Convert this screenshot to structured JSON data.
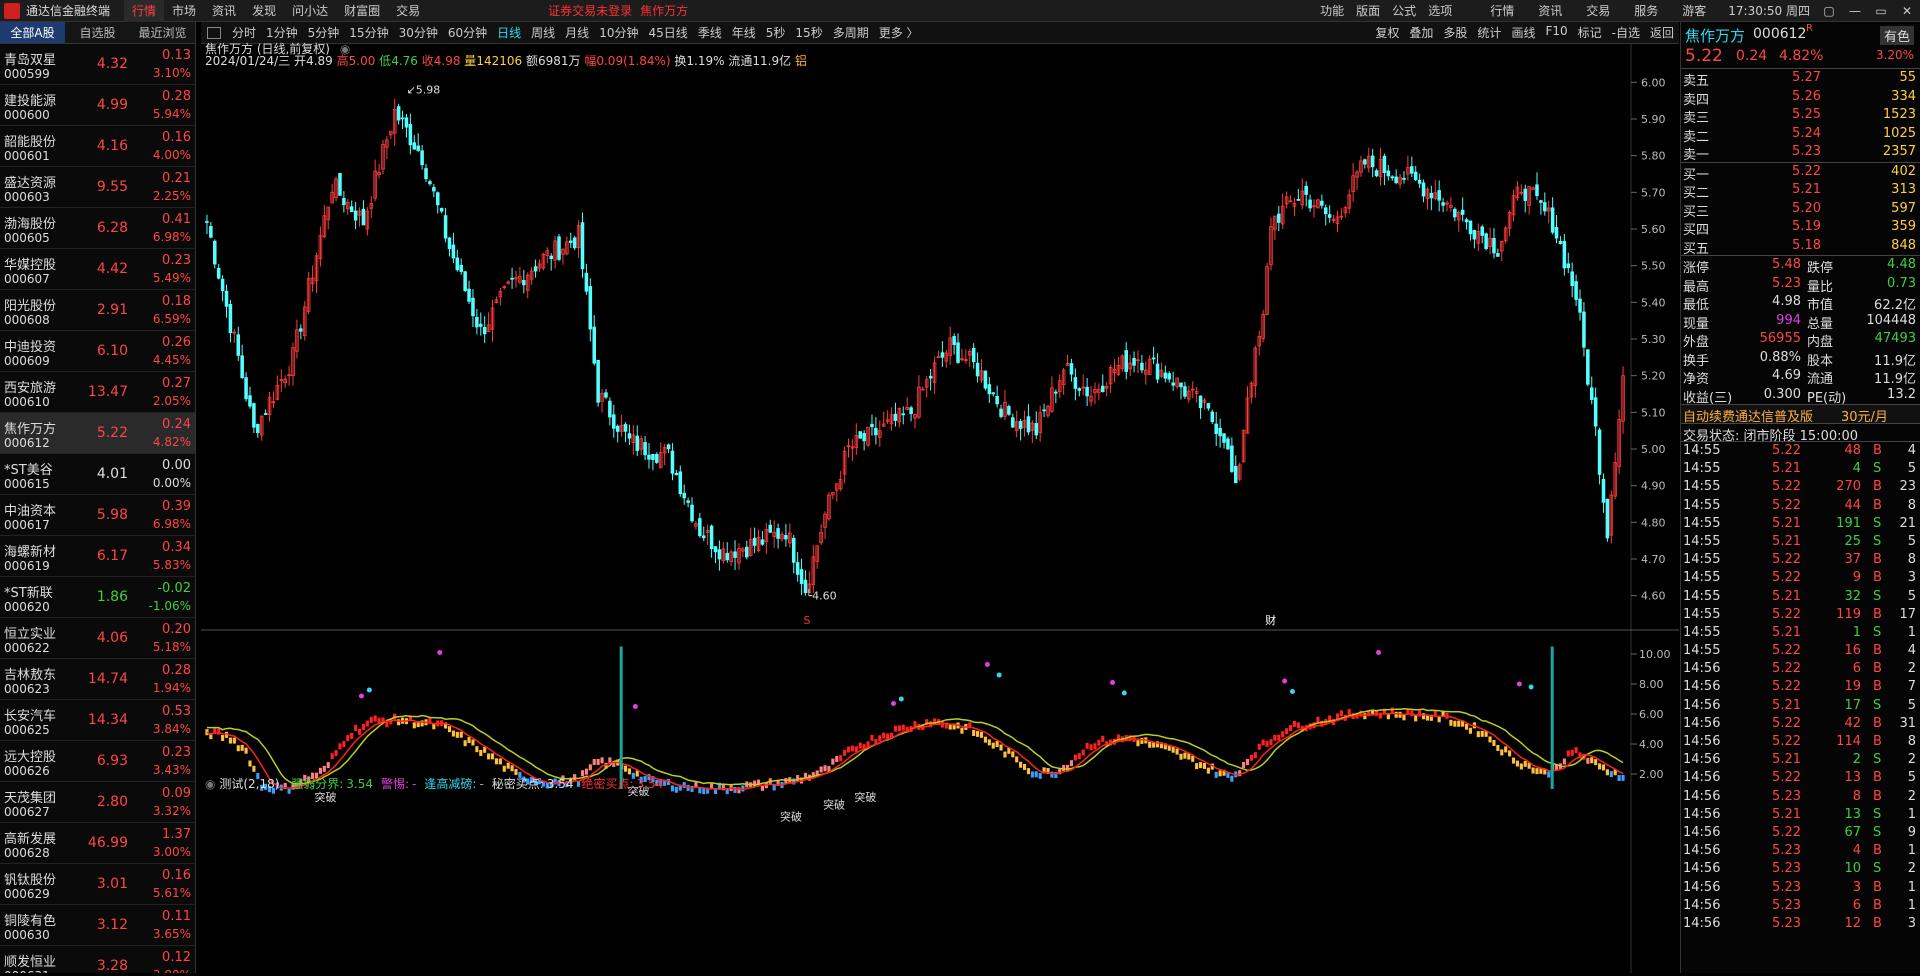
{
  "app": {
    "title": "通达信金融终端",
    "menus": [
      "行情",
      "市场",
      "资讯",
      "发现",
      "问小达",
      "财富圈",
      "交易"
    ],
    "active_menu": "行情",
    "notice": "证券交易未登录",
    "stock_in_title": "焦作万方",
    "right_menus": [
      "功能",
      "版面",
      "公式",
      "选项"
    ],
    "right_tabs": [
      "行情",
      "资讯",
      "交易",
      "服务",
      "游客"
    ],
    "clock": "17:30:50 周四",
    "win_buttons": [
      "▢",
      "—",
      "▭",
      "✕"
    ]
  },
  "sidebar": {
    "tabs": [
      "全部A股",
      "自选股",
      "最近浏览"
    ],
    "stocks": [
      {
        "name": "青岛双星",
        "code": "000599",
        "price": "4.32",
        "chg": "0.13",
        "pct": "3.10%",
        "c": "up",
        "nc": "fl"
      },
      {
        "name": "建投能源",
        "code": "000600",
        "price": "4.99",
        "chg": "0.28",
        "pct": "5.94%",
        "c": "up",
        "nc": "fl"
      },
      {
        "name": "韶能股份",
        "code": "000601",
        "price": "4.16",
        "chg": "0.16",
        "pct": "4.00%",
        "c": "up",
        "nc": "fl"
      },
      {
        "name": "盛达资源",
        "code": "000603",
        "price": "9.55",
        "chg": "0.21",
        "pct": "2.25%",
        "c": "up",
        "nc": "fl"
      },
      {
        "name": "渤海股份",
        "code": "000605",
        "price": "6.28",
        "chg": "0.41",
        "pct": "6.98%",
        "c": "up",
        "nc": "cy"
      },
      {
        "name": "华媒控股",
        "code": "000607",
        "price": "4.42",
        "chg": "0.23",
        "pct": "5.49%",
        "c": "up",
        "nc": "cy"
      },
      {
        "name": "阳光股份",
        "code": "000608",
        "price": "2.91",
        "chg": "0.18",
        "pct": "6.59%",
        "c": "up",
        "nc": "cy"
      },
      {
        "name": "中迪投资",
        "code": "000609",
        "price": "6.10",
        "chg": "0.26",
        "pct": "4.45%",
        "c": "up",
        "nc": "cy"
      },
      {
        "name": "西安旅游",
        "code": "000610",
        "price": "13.47",
        "chg": "0.27",
        "pct": "2.05%",
        "c": "up",
        "nc": "cy"
      },
      {
        "name": "焦作万方",
        "code": "000612",
        "price": "5.22",
        "chg": "0.24",
        "pct": "4.82%",
        "c": "up",
        "nc": "cy",
        "sel": true
      },
      {
        "name": "*ST美谷",
        "code": "000615",
        "price": "4.01",
        "chg": "0.00",
        "pct": "0.00%",
        "c": "fl",
        "nc": "cy"
      },
      {
        "name": "中油资本",
        "code": "000617",
        "price": "5.98",
        "chg": "0.39",
        "pct": "6.98%",
        "c": "up",
        "nc": "fl"
      },
      {
        "name": "海螺新材",
        "code": "000619",
        "price": "6.17",
        "chg": "0.34",
        "pct": "5.83%",
        "c": "up",
        "nc": "fl"
      },
      {
        "name": "*ST新联",
        "code": "000620",
        "price": "1.86",
        "chg": "-0.02",
        "pct": "-1.06%",
        "c": "dn",
        "nc": "fl"
      },
      {
        "name": "恒立实业",
        "code": "000622",
        "price": "4.06",
        "chg": "0.20",
        "pct": "5.18%",
        "c": "up",
        "nc": "cy"
      },
      {
        "name": "吉林敖东",
        "code": "000623",
        "price": "14.74",
        "chg": "0.28",
        "pct": "1.94%",
        "c": "up",
        "nc": "fl"
      },
      {
        "name": "长安汽车",
        "code": "000625",
        "price": "14.34",
        "chg": "0.53",
        "pct": "3.84%",
        "c": "up",
        "nc": "fl"
      },
      {
        "name": "远大控股",
        "code": "000626",
        "price": "6.93",
        "chg": "0.23",
        "pct": "3.43%",
        "c": "up",
        "nc": "cy"
      },
      {
        "name": "天茂集团",
        "code": "000627",
        "price": "2.80",
        "chg": "0.09",
        "pct": "3.32%",
        "c": "up",
        "nc": "fl"
      },
      {
        "name": "高新发展",
        "code": "000628",
        "price": "46.99",
        "chg": "1.37",
        "pct": "3.00%",
        "c": "up",
        "nc": "cy"
      },
      {
        "name": "钒钛股份",
        "code": "000629",
        "price": "3.01",
        "chg": "0.16",
        "pct": "5.61%",
        "c": "up",
        "nc": "fl"
      },
      {
        "name": "铜陵有色",
        "code": "000630",
        "price": "3.12",
        "chg": "0.11",
        "pct": "3.65%",
        "c": "up",
        "nc": "fl"
      },
      {
        "name": "顺发恒业",
        "code": "000631",
        "price": "3.28",
        "chg": "0.12",
        "pct": "3.80%",
        "c": "up",
        "nc": "fl"
      }
    ]
  },
  "periods": {
    "items": [
      "分时",
      "1分钟",
      "5分钟",
      "15分钟",
      "30分钟",
      "60分钟",
      "日线",
      "周线",
      "月线",
      "10分钟",
      "45日线",
      "季线",
      "年线",
      "5秒",
      "15秒",
      "多周期",
      "更多 〉"
    ],
    "active": "日线",
    "tools": [
      "复权",
      "叠加",
      "多股",
      "统计",
      "画线",
      "F10",
      "标记",
      "-自选",
      "返回"
    ]
  },
  "chart_data": {
    "type": "candlestick",
    "title": "焦作万方 (日线,前复权)",
    "info": {
      "date": "2024/01/24/三",
      "open_label": "开",
      "open": "4.89",
      "high_label": "高",
      "high": "5.00",
      "low_label": "低",
      "low": "4.76",
      "close_label": "收",
      "close": "4.98",
      "vol_label": "量",
      "vol": "142106",
      "amt_label": "额",
      "amt": "6981万",
      "rng_label": "幅",
      "rng": "0.09(1.84%)",
      "turn_label": "换",
      "turn": "1.19%",
      "float_label": "流通",
      "float": "11.9亿",
      "tag": "铝"
    },
    "ylim": [
      4.55,
      6.05
    ],
    "yticks": [
      "6.00",
      "5.90",
      "5.80",
      "5.70",
      "5.60",
      "5.50",
      "5.40",
      "5.30",
      "5.20",
      "5.10",
      "5.00",
      "4.90",
      "4.80",
      "4.70",
      "4.60"
    ],
    "max_label": "5.98",
    "min_label": "4.60",
    "markers": [
      "S",
      "财"
    ],
    "keypoints": [
      [
        0,
        5.62
      ],
      [
        8,
        5.25
      ],
      [
        12,
        5.05
      ],
      [
        22,
        5.25
      ],
      [
        32,
        5.72
      ],
      [
        40,
        5.62
      ],
      [
        48,
        5.92
      ],
      [
        55,
        5.8
      ],
      [
        62,
        5.55
      ],
      [
        70,
        5.32
      ],
      [
        78,
        5.45
      ],
      [
        86,
        5.52
      ],
      [
        95,
        5.58
      ],
      [
        100,
        5.15
      ],
      [
        108,
        5.02
      ],
      [
        118,
        4.98
      ],
      [
        126,
        4.78
      ],
      [
        132,
        4.72
      ],
      [
        140,
        4.74
      ],
      [
        148,
        4.78
      ],
      [
        153,
        4.62
      ],
      [
        158,
        4.82
      ],
      [
        164,
        5.0
      ],
      [
        172,
        5.05
      ],
      [
        180,
        5.1
      ],
      [
        186,
        5.22
      ],
      [
        190,
        5.28
      ],
      [
        197,
        5.22
      ],
      [
        204,
        5.1
      ],
      [
        212,
        5.05
      ],
      [
        219,
        5.22
      ],
      [
        226,
        5.15
      ],
      [
        232,
        5.22
      ],
      [
        238,
        5.25
      ],
      [
        246,
        5.2
      ],
      [
        254,
        5.12
      ],
      [
        260,
        5.04
      ],
      [
        263,
        4.88
      ],
      [
        266,
        5.15
      ],
      [
        270,
        5.35
      ],
      [
        272,
        5.62
      ],
      [
        280,
        5.7
      ],
      [
        288,
        5.62
      ],
      [
        296,
        5.78
      ],
      [
        305,
        5.75
      ],
      [
        314,
        5.7
      ],
      [
        322,
        5.62
      ],
      [
        330,
        5.55
      ],
      [
        336,
        5.72
      ],
      [
        344,
        5.62
      ],
      [
        350,
        5.42
      ],
      [
        355,
        5.05
      ],
      [
        358,
        4.78
      ],
      [
        362,
        5.2
      ]
    ],
    "indicator": {
      "title": "测试(2,18)",
      "items": [
        {
          "label": "强弱分界:",
          "value": "3.54",
          "color": "#3fcf3f"
        },
        {
          "label": "警惕:",
          "value": "-",
          "color": "#e040e0"
        },
        {
          "label": "逢高减磅:",
          "value": "-",
          "color": "#2fd8f0"
        },
        {
          "label": "秘密买点:",
          "value": "3.54",
          "color": "#dddddd"
        },
        {
          "label": "绝密买点:",
          "value": "3.54",
          "color": "#ff3030"
        }
      ],
      "yticks": [
        "10.00",
        "8.00",
        "6.00",
        "4.00",
        "2.00"
      ],
      "ylim": [
        0,
        11
      ],
      "labels": [
        "突破",
        "突破",
        "突破",
        "突破",
        "突破"
      ],
      "keypoints": [
        [
          0,
          4.8
        ],
        [
          6,
          4.4
        ],
        [
          10,
          3.5
        ],
        [
          14,
          1.2
        ],
        [
          20,
          1.0
        ],
        [
          30,
          2.2
        ],
        [
          36,
          4.6
        ],
        [
          42,
          5.5
        ],
        [
          50,
          5.6
        ],
        [
          60,
          5.2
        ],
        [
          70,
          3.6
        ],
        [
          80,
          1.8
        ],
        [
          88,
          1.4
        ],
        [
          95,
          1.6
        ],
        [
          100,
          2.8
        ],
        [
          106,
          2.6
        ],
        [
          112,
          1.6
        ],
        [
          120,
          1.2
        ],
        [
          130,
          1.0
        ],
        [
          140,
          1.2
        ],
        [
          148,
          1.4
        ],
        [
          158,
          2.2
        ],
        [
          166,
          3.8
        ],
        [
          175,
          4.8
        ],
        [
          185,
          5.5
        ],
        [
          195,
          5.0
        ],
        [
          204,
          3.5
        ],
        [
          212,
          2.0
        ],
        [
          218,
          2.2
        ],
        [
          226,
          4.0
        ],
        [
          236,
          4.4
        ],
        [
          246,
          3.6
        ],
        [
          256,
          2.4
        ],
        [
          262,
          1.7
        ],
        [
          268,
          3.5
        ],
        [
          276,
          5.0
        ],
        [
          286,
          5.6
        ],
        [
          296,
          6.1
        ],
        [
          306,
          6.0
        ],
        [
          316,
          5.8
        ],
        [
          326,
          4.8
        ],
        [
          334,
          3.0
        ],
        [
          342,
          2.0
        ],
        [
          350,
          3.5
        ],
        [
          356,
          2.4
        ],
        [
          362,
          1.9
        ]
      ]
    }
  },
  "panel": {
    "name": "焦作万方",
    "code": "000612",
    "mark": "R",
    "sector": "有色",
    "price": "5.22",
    "chg": "0.24",
    "pct": "4.82%",
    "pct2": "3.20%",
    "asks": [
      [
        "卖五",
        "5.27",
        "55"
      ],
      [
        "卖四",
        "5.26",
        "334"
      ],
      [
        "卖三",
        "5.25",
        "1523"
      ],
      [
        "卖二",
        "5.24",
        "1025"
      ],
      [
        "卖一",
        "5.23",
        "2357"
      ]
    ],
    "bids": [
      [
        "买一",
        "5.22",
        "402"
      ],
      [
        "买二",
        "5.21",
        "313"
      ],
      [
        "买三",
        "5.20",
        "597"
      ],
      [
        "买四",
        "5.19",
        "359"
      ],
      [
        "买五",
        "5.18",
        "848"
      ]
    ],
    "stats": [
      [
        "涨停",
        "5.48",
        "up",
        "跌停",
        "4.48",
        "dn"
      ],
      [
        "最高",
        "5.23",
        "up",
        "量比",
        "0.73",
        "dn"
      ],
      [
        "最低",
        "4.98",
        "fl",
        "市值",
        "62.2亿",
        "fl"
      ],
      [
        "现量",
        "994",
        "mg",
        "总量",
        "104448",
        "fl"
      ],
      [
        "外盘",
        "56955",
        "up",
        "内盘",
        "47493",
        "dn"
      ],
      [
        "换手",
        "0.88%",
        "fl",
        "股本",
        "11.9亿",
        "fl"
      ],
      [
        "净资",
        "4.69",
        "fl",
        "流通",
        "11.9亿",
        "fl"
      ],
      [
        "收益(三)",
        "0.300",
        "fl",
        "PE(动)",
        "13.2",
        "fl"
      ]
    ],
    "promo": "自动续费通达信普及版",
    "promo_price": "30元/月",
    "status": "交易状态: 闭市阶段 15:00:00",
    "ticks": [
      [
        "14:55",
        "5.22",
        "48",
        "B",
        "4"
      ],
      [
        "14:55",
        "5.21",
        "4",
        "S",
        "5"
      ],
      [
        "14:55",
        "5.22",
        "270",
        "B",
        "23"
      ],
      [
        "14:55",
        "5.22",
        "44",
        "B",
        "8"
      ],
      [
        "14:55",
        "5.21",
        "191",
        "S",
        "21"
      ],
      [
        "14:55",
        "5.21",
        "25",
        "S",
        "5"
      ],
      [
        "14:55",
        "5.22",
        "37",
        "B",
        "8"
      ],
      [
        "14:55",
        "5.22",
        "9",
        "B",
        "3"
      ],
      [
        "14:55",
        "5.21",
        "32",
        "S",
        "5"
      ],
      [
        "14:55",
        "5.22",
        "119",
        "B",
        "17"
      ],
      [
        "14:55",
        "5.21",
        "1",
        "S",
        "1"
      ],
      [
        "14:55",
        "5.22",
        "16",
        "B",
        "4"
      ],
      [
        "14:56",
        "5.22",
        "6",
        "B",
        "2"
      ],
      [
        "14:56",
        "5.22",
        "19",
        "B",
        "7"
      ],
      [
        "14:56",
        "5.21",
        "17",
        "S",
        "5"
      ],
      [
        "14:56",
        "5.22",
        "42",
        "B",
        "31"
      ],
      [
        "14:56",
        "5.22",
        "114",
        "B",
        "8"
      ],
      [
        "14:56",
        "5.21",
        "2",
        "S",
        "2"
      ],
      [
        "14:56",
        "5.22",
        "13",
        "B",
        "5"
      ],
      [
        "14:56",
        "5.23",
        "8",
        "B",
        "2"
      ],
      [
        "14:56",
        "5.21",
        "13",
        "S",
        "1"
      ],
      [
        "14:56",
        "5.22",
        "67",
        "S",
        "9"
      ],
      [
        "14:56",
        "5.23",
        "4",
        "B",
        "1"
      ],
      [
        "14:56",
        "5.23",
        "10",
        "S",
        "2"
      ],
      [
        "14:56",
        "5.23",
        "3",
        "B",
        "1"
      ],
      [
        "14:56",
        "5.23",
        "6",
        "B",
        "1"
      ],
      [
        "14:56",
        "5.23",
        "12",
        "B",
        "3"
      ]
    ]
  }
}
